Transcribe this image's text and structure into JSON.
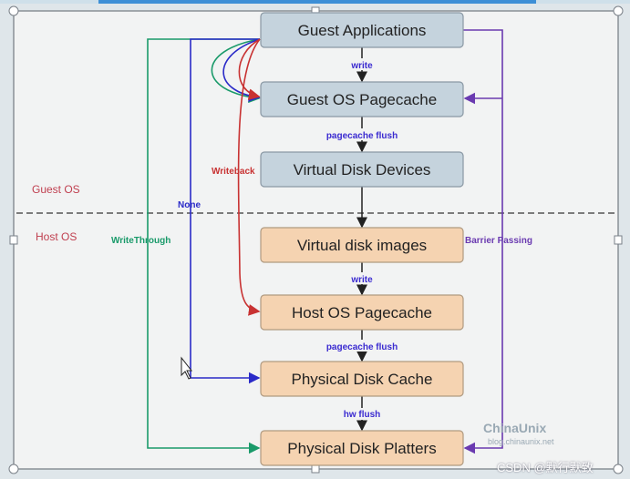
{
  "boxes": {
    "guest": [
      {
        "label": "Guest Applications"
      },
      {
        "label": "Guest OS Pagecache"
      },
      {
        "label": "Virtual Disk Devices"
      }
    ],
    "host": [
      {
        "label": "Virtual disk images"
      },
      {
        "label": "Host OS Pagecache"
      },
      {
        "label": "Physical Disk Cache"
      },
      {
        "label": "Physical Disk Platters"
      }
    ]
  },
  "edges": {
    "write1": "write",
    "flush1": "pagecache flush",
    "write2": "write",
    "flush2": "pagecache flush",
    "hwflush": "hw flush"
  },
  "regions": {
    "guest": "Guest OS",
    "host": "Host OS"
  },
  "modes": {
    "writethrough": "WriteThrough",
    "none": "None",
    "writeback": "Writeback",
    "barrier": "Barrier Passing"
  },
  "colors": {
    "guest_box": "#c5d3dd",
    "host_box": "#f5d3b1",
    "writethrough": "#1a9a6a",
    "none": "#2a2ac8",
    "writeback": "#c83232",
    "barrier": "#6a3ab0",
    "edge_label": "#3a2ad0",
    "region_label": "#c04050"
  },
  "watermark": {
    "brand": "ChinaUnix",
    "url": "blog.chinaunix.net",
    "csdn": "CSDN @默行默致"
  }
}
